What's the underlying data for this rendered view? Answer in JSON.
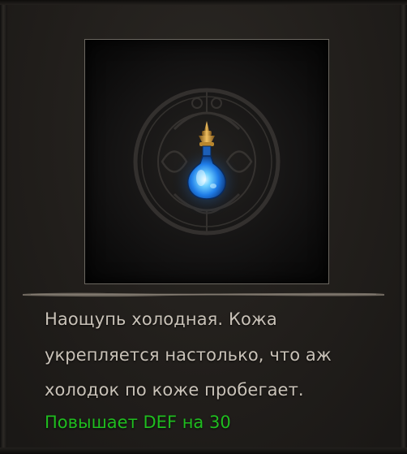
{
  "item": {
    "icon": "blue-potion-icon",
    "emblem": "rune-circle-emblem",
    "description_lines": [
      "Наощупь холодная. Кожа",
      "укрепляется настолько, что аж",
      "холодок по коже пробегает."
    ],
    "bonus": "Повышает DEF на 30"
  },
  "colors": {
    "background": "#211e1b",
    "frame_border": "#6b6760",
    "description_text": "#c9c2b8",
    "bonus_text": "#1fbd1f",
    "potion_liquid": "#2f8dff",
    "potion_cap": "#c99a3a"
  }
}
